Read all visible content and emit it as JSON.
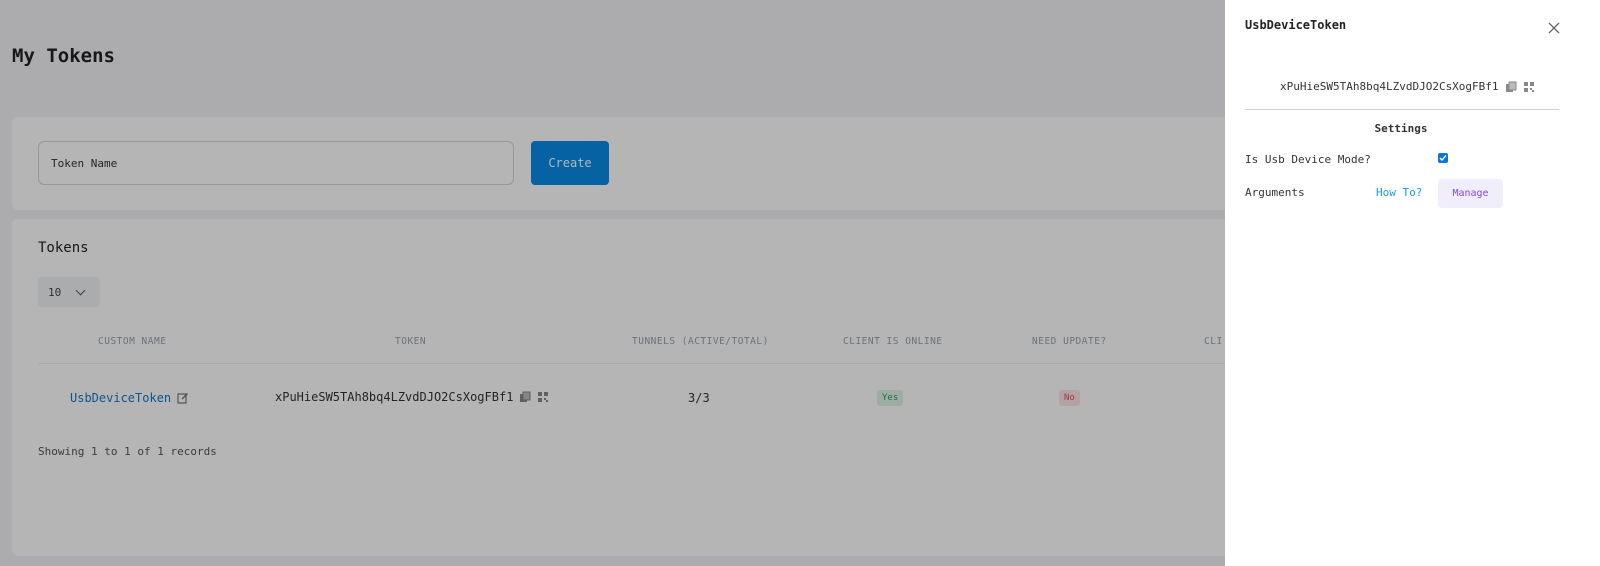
{
  "page": {
    "title": "My Tokens"
  },
  "create": {
    "placeholder": "Token Name",
    "button_label": "Create"
  },
  "tokens_card": {
    "title": "Tokens",
    "page_size": "10",
    "columns": [
      "CUSTOM NAME",
      "TOKEN",
      "TUNNELS (ACTIVE/TOTAL)",
      "CLIENT IS ONLINE",
      "NEED UPDATE?",
      "CLI"
    ],
    "rows": [
      {
        "custom_name": "UsbDeviceToken",
        "token": "xPuHieSW5TAh8bq4LZvdDJO2CsXogFBf1",
        "tunnels": "3/3",
        "online": "Yes",
        "need_update": "No"
      }
    ],
    "showing": "Showing 1 to 1 of 1 records"
  },
  "drawer": {
    "title": "UsbDeviceToken",
    "token": "xPuHieSW5TAh8bq4LZvdDJO2CsXogFBf1",
    "settings_heading": "Settings",
    "usb_mode_label": "Is Usb Device Mode?",
    "usb_mode_checked": true,
    "arguments_label": "Arguments",
    "howto_label": "How To?",
    "manage_label": "Manage"
  },
  "colors": {
    "primary": "#0a8be8",
    "link": "#1677c9",
    "success": "#25a35a",
    "danger": "#e34b57",
    "manage": "#7b4cd9"
  }
}
